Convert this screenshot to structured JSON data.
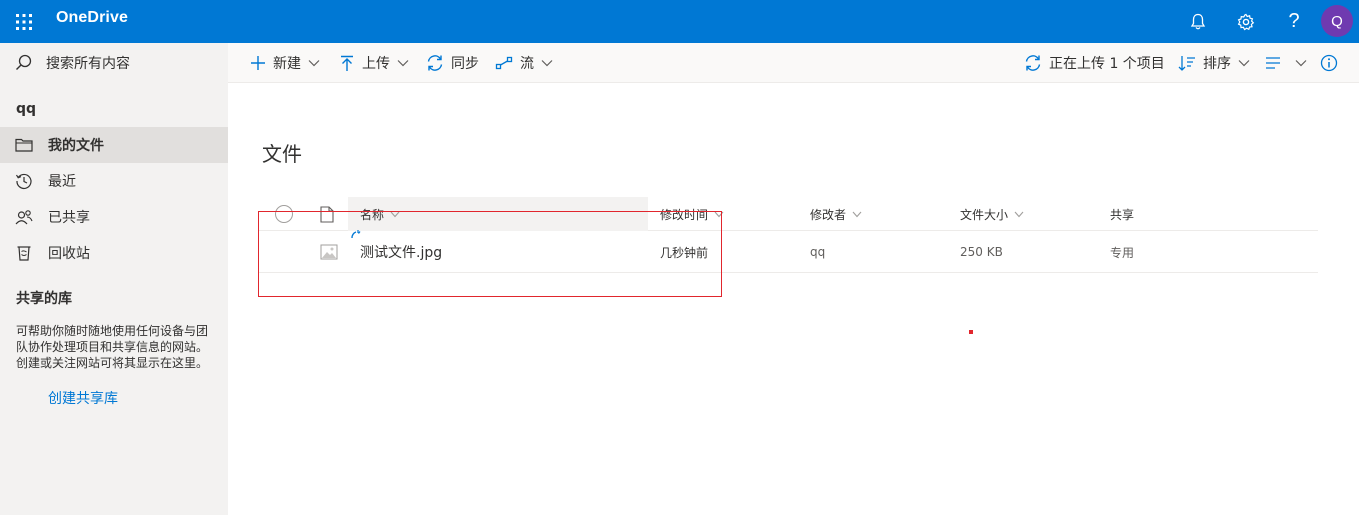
{
  "app": {
    "brand": "OneDrive",
    "avatar_initial": "Q",
    "accent": "#0078d4"
  },
  "topbar_icons": [
    "waffle-icon",
    "bell-icon",
    "gear-icon",
    "help-icon"
  ],
  "help_glyph": "?",
  "search": {
    "placeholder": "搜索所有内容"
  },
  "nav": {
    "user": "qq",
    "items": [
      {
        "label": "我的文件",
        "icon": "folder-icon",
        "active": true
      },
      {
        "label": "最近",
        "icon": "history-icon",
        "active": false
      },
      {
        "label": "已共享",
        "icon": "people-icon",
        "active": false
      },
      {
        "label": "回收站",
        "icon": "recycle-bin-icon",
        "active": false
      }
    ],
    "shared_libraries": {
      "title": "共享的库",
      "description": "可帮助你随时随地使用任何设备与团队协作处理项目和共享信息的网站。创建或关注网站可将其显示在这里。",
      "create_link": "创建共享库"
    }
  },
  "commandbar": {
    "new": "新建",
    "upload": "上传",
    "sync": "同步",
    "flow": "流",
    "status": "正在上传 1 个项目",
    "sort": "排序"
  },
  "main": {
    "title": "文件",
    "columns": {
      "name": "名称",
      "modified": "修改时间",
      "modified_by": "修改者",
      "size": "文件大小",
      "sharing": "共享"
    },
    "files": [
      {
        "name": "测试文件.jpg",
        "modified": "几秒钟前",
        "modified_by": "qq",
        "size": "250 KB",
        "sharing": "专用"
      }
    ]
  }
}
